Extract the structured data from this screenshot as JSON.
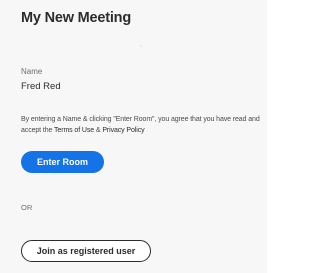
{
  "meeting": {
    "title": "My New Meeting"
  },
  "guest_form": {
    "name_label": "Name",
    "name_value": "Fred Red",
    "consent_text_before": "By entering a Name & clicking \"Enter Room\", you agree that you have read and accept the ",
    "terms_link": "Terms of Use",
    "consent_text_between": " & ",
    "privacy_link": "Privacy Policy",
    "enter_button_label": "Enter Room"
  },
  "divider": {
    "or_label": "OR"
  },
  "registered": {
    "button_label": "Join as registered user"
  },
  "colors": {
    "accent": "#1473e6",
    "background": "#f7f7f7",
    "text": "#2c2c2c"
  }
}
